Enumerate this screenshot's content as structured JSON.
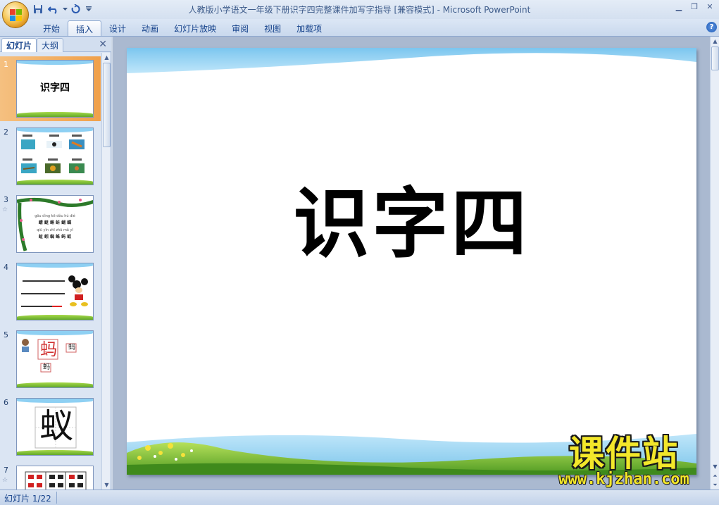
{
  "window": {
    "title": "人教版小学语文一年级下册识字四完整课件加写字指导 [兼容模式] - Microsoft PowerPoint"
  },
  "quick_access": [
    {
      "name": "save-icon"
    },
    {
      "name": "undo-icon"
    },
    {
      "name": "redo-icon"
    },
    {
      "name": "customize-icon"
    }
  ],
  "ribbon": {
    "tabs": [
      "开始",
      "插入",
      "设计",
      "动画",
      "幻灯片放映",
      "审阅",
      "视图",
      "加载项"
    ],
    "active_tab": "插入"
  },
  "left_panel": {
    "tab_slides": "幻灯片",
    "tab_outline": "大纲"
  },
  "thumbnails": [
    {
      "num": "1",
      "title": "识字四",
      "selected": true
    },
    {
      "num": "2"
    },
    {
      "num": "3",
      "has_animation": true,
      "pinyin1": "gōu dìng   kē dǒu   hú dié",
      "chars1": "蜻 蜓   蝌 蚪   蝴 蝶",
      "pinyin2": "qiū yǐn   zhī zhū   mǎ yǐ",
      "chars2": "蚯 蚓   蜘 蛛   蚂 蚁"
    },
    {
      "num": "4"
    },
    {
      "num": "5",
      "char": "蚂"
    },
    {
      "num": "6",
      "char": "蚁"
    },
    {
      "num": "7",
      "has_animation": true
    }
  ],
  "slide": {
    "title": "识字四"
  },
  "watermark": {
    "cn": "课件站",
    "url": "www.kjzhan.com"
  },
  "status": {
    "slide_indicator": "幻灯片 1/22"
  },
  "colors": {
    "accent": "#15428b",
    "selected_thumb": "#f0a04a",
    "sky": "#8ed0f3",
    "grass": "#62a82a",
    "watermark_yellow": "#f3e72a"
  }
}
